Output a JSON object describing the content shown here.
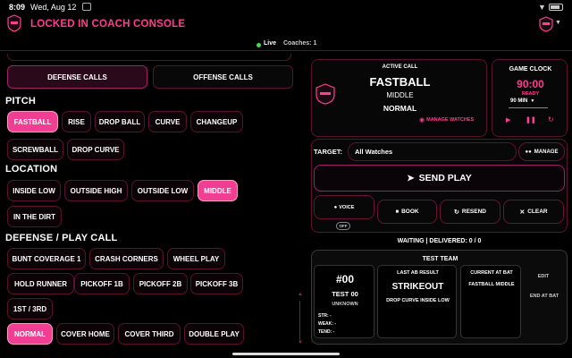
{
  "status_bar": {
    "time": "8:09",
    "date": "Wed, Aug 12"
  },
  "header": {
    "title": "LOCKED IN COACH CONSOLE"
  },
  "connection": {
    "live_label": "Live",
    "coaches_label": "Coaches: 1"
  },
  "tabs": {
    "defense": "DEFENSE CALLS",
    "offense": "OFFENSE CALLS",
    "active": "defense"
  },
  "pitch": {
    "label": "PITCH",
    "items": [
      "FASTBALL",
      "RISE",
      "DROP BALL",
      "CURVE",
      "CHANGEUP",
      "SCREWBALL",
      "DROP CURVE"
    ],
    "selected": "FASTBALL"
  },
  "location": {
    "label": "LOCATION",
    "items": [
      "INSIDE LOW",
      "OUTSIDE HIGH",
      "OUTSIDE LOW",
      "MIDDLE",
      "IN THE DIRT"
    ],
    "selected": "MIDDLE"
  },
  "defense_play": {
    "label": "DEFENSE / PLAY CALL",
    "items": [
      "BUNT COVERAGE 1",
      "CRASH CORNERS",
      "WHEEL PLAY",
      "HOLD RUNNER",
      "PICKOFF 1B",
      "PICKOFF 2B",
      "PICKOFF 3B",
      "1ST / 3RD",
      "NORMAL",
      "COVER HOME",
      "COVER THIRD",
      "DOUBLE PLAY"
    ],
    "selected": "NORMAL"
  },
  "active_call": {
    "label": "ACTIVE CALL",
    "pitch": "FASTBALL",
    "location": "MIDDLE",
    "play": "NORMAL",
    "manage_watches": "MANAGE WATCHES"
  },
  "game_clock": {
    "label": "GAME CLOCK",
    "time": "90:00",
    "status": "READY",
    "duration": "90 MIN"
  },
  "target": {
    "label": "TARGET:",
    "value": "All Watches",
    "manage": "MANAGE"
  },
  "actions": {
    "send_play": "SEND PLAY",
    "voice": "VOICE",
    "voice_toggle": "OFF",
    "book": "BOOK",
    "resend": "RESEND",
    "clear": "CLEAR"
  },
  "delivery_status": "WAITING | DELIVERED: 0 / 0",
  "test_team": {
    "label": "TEST TEAM",
    "player": {
      "number": "#00",
      "name": "TEST 00",
      "position": "UNKNOWN",
      "str": "STR: -",
      "weak": "WEAK: -",
      "tend": "TEND: -"
    },
    "last_ab": {
      "label": "LAST AB RESULT",
      "result": "STRIKEOUT",
      "detail": "DROP CURVE INSIDE LOW"
    },
    "current_ab": {
      "label": "CURRENT AT BAT",
      "detail": "FASTBALL MIDDLE"
    },
    "edit": "EDIT",
    "end_at_bat": "END AT BAT"
  },
  "colors": {
    "accent": "#f03f93",
    "border": "#5b1130",
    "ready": "#ff3d8f"
  }
}
